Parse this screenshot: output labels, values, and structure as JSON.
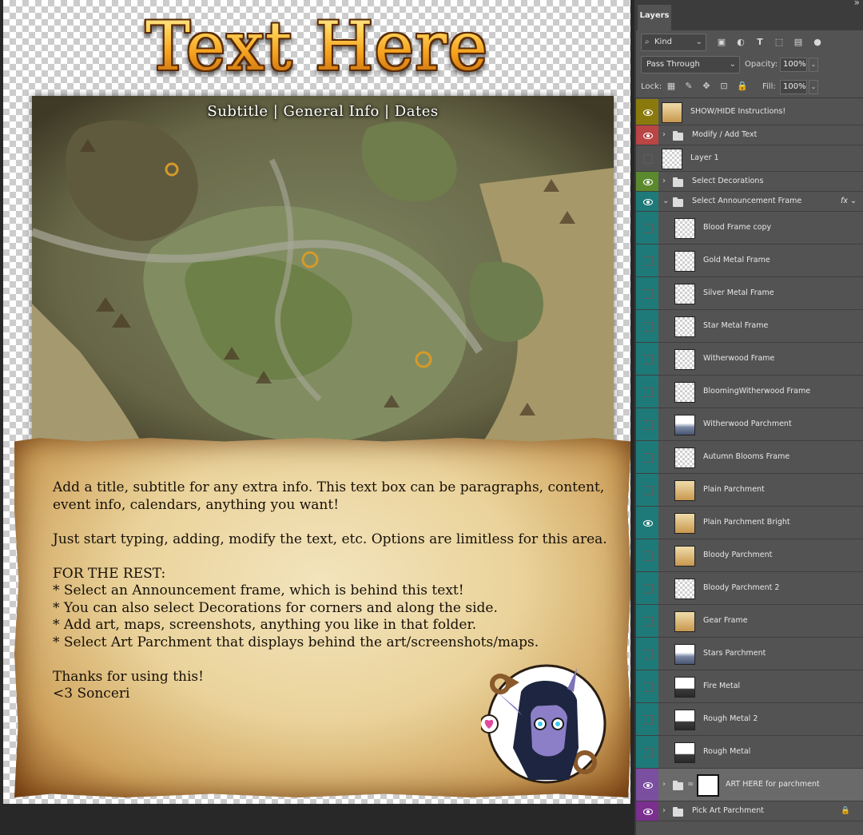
{
  "canvas": {
    "title": "Text Here",
    "subtitle": "Subtitle | General Info | Dates",
    "body_lines": [
      "Add a title, subtitle for any extra info. This text box can be paragraphs, content,",
      "event info, calendars, anything you want!",
      "",
      "Just start typing, adding, modify the text, etc. Options are limitless for this area.",
      "",
      "FOR THE REST:",
      "* Select an Announcement frame, which is behind this text!",
      "* You can also select Decorations for corners and along the side.",
      "* Add art, maps, screenshots, anything you like in that folder.",
      "* Select Art Parchment that displays behind the art/screenshots/maps.",
      "",
      "Thanks for using this!",
      "<3 Sonceri"
    ]
  },
  "panel": {
    "tab": "Layers",
    "filter_kind": "Kind",
    "blend_mode": "Pass Through",
    "opacity_label": "Opacity:",
    "opacity_value": "100%",
    "lock_label": "Lock:",
    "fill_label": "Fill:",
    "fill_value": "100%",
    "fx": "fx",
    "layers": [
      {
        "name": "SHOW/HIDE Instructions!",
        "type": "layer",
        "visible": true,
        "color": "#8a7a0d",
        "thumb": "parch"
      },
      {
        "name": "Modify / Add Text",
        "type": "group",
        "visible": true,
        "color": "#b94545"
      },
      {
        "name": "Layer 1",
        "type": "layer",
        "visible": false,
        "color": "",
        "thumb": "blank"
      },
      {
        "name": "Select Decorations",
        "type": "group",
        "visible": true,
        "color": "#5b8a2e"
      },
      {
        "name": "Select Announcement Frame",
        "type": "group-open",
        "visible": true,
        "color": "#1e7a78"
      },
      {
        "name": "Blood Frame copy",
        "type": "child",
        "visible": false,
        "color": "#1e7a78",
        "thumb": "frame"
      },
      {
        "name": "Gold Metal Frame",
        "type": "child",
        "visible": false,
        "color": "#1e7a78",
        "thumb": "frame"
      },
      {
        "name": "Silver Metal Frame",
        "type": "child",
        "visible": false,
        "color": "#1e7a78",
        "thumb": "frame"
      },
      {
        "name": "Star Metal Frame",
        "type": "child",
        "visible": false,
        "color": "#1e7a78",
        "thumb": "frame"
      },
      {
        "name": "Witherwood Frame",
        "type": "child",
        "visible": false,
        "color": "#1e7a78",
        "thumb": "frame"
      },
      {
        "name": "BloomingWitherwood Frame",
        "type": "child",
        "visible": false,
        "color": "#1e7a78",
        "thumb": "frame"
      },
      {
        "name": "Witherwood Parchment",
        "type": "child",
        "visible": false,
        "color": "#1e7a78",
        "thumb": "blue"
      },
      {
        "name": "Autumn Blooms Frame",
        "type": "child",
        "visible": false,
        "color": "#1e7a78",
        "thumb": "frame"
      },
      {
        "name": "Plain Parchment",
        "type": "child",
        "visible": false,
        "color": "#1e7a78",
        "thumb": "parch"
      },
      {
        "name": "Plain Parchment Bright",
        "type": "child",
        "visible": true,
        "color": "#1e7a78",
        "thumb": "parch"
      },
      {
        "name": "Bloody Parchment",
        "type": "child",
        "visible": false,
        "color": "#1e7a78",
        "thumb": "parch"
      },
      {
        "name": "Bloody Parchment 2",
        "type": "child",
        "visible": false,
        "color": "#1e7a78",
        "thumb": "frame"
      },
      {
        "name": "Gear Frame",
        "type": "child",
        "visible": false,
        "color": "#1e7a78",
        "thumb": "parch"
      },
      {
        "name": "Stars Parchment",
        "type": "child",
        "visible": false,
        "color": "#1e7a78",
        "thumb": "blue"
      },
      {
        "name": "Fire Metal",
        "type": "child",
        "visible": false,
        "color": "#1e7a78",
        "thumb": "dark"
      },
      {
        "name": "Rough Metal 2",
        "type": "child",
        "visible": false,
        "color": "#1e7a78",
        "thumb": "dark"
      },
      {
        "name": "Rough Metal",
        "type": "child",
        "visible": false,
        "color": "#1e7a78",
        "thumb": "dark"
      },
      {
        "name": "ART HERE for parchment",
        "type": "group-mask",
        "visible": true,
        "color": "#7b4fa0",
        "selected": true
      },
      {
        "name": "Pick Art Parchment",
        "type": "group-locked",
        "visible": true,
        "color": "#7b2f8f"
      }
    ]
  },
  "colors": {
    "title_gold": "#f6b12c",
    "panel_bg": "#535353",
    "parchment": "#ead39b"
  }
}
